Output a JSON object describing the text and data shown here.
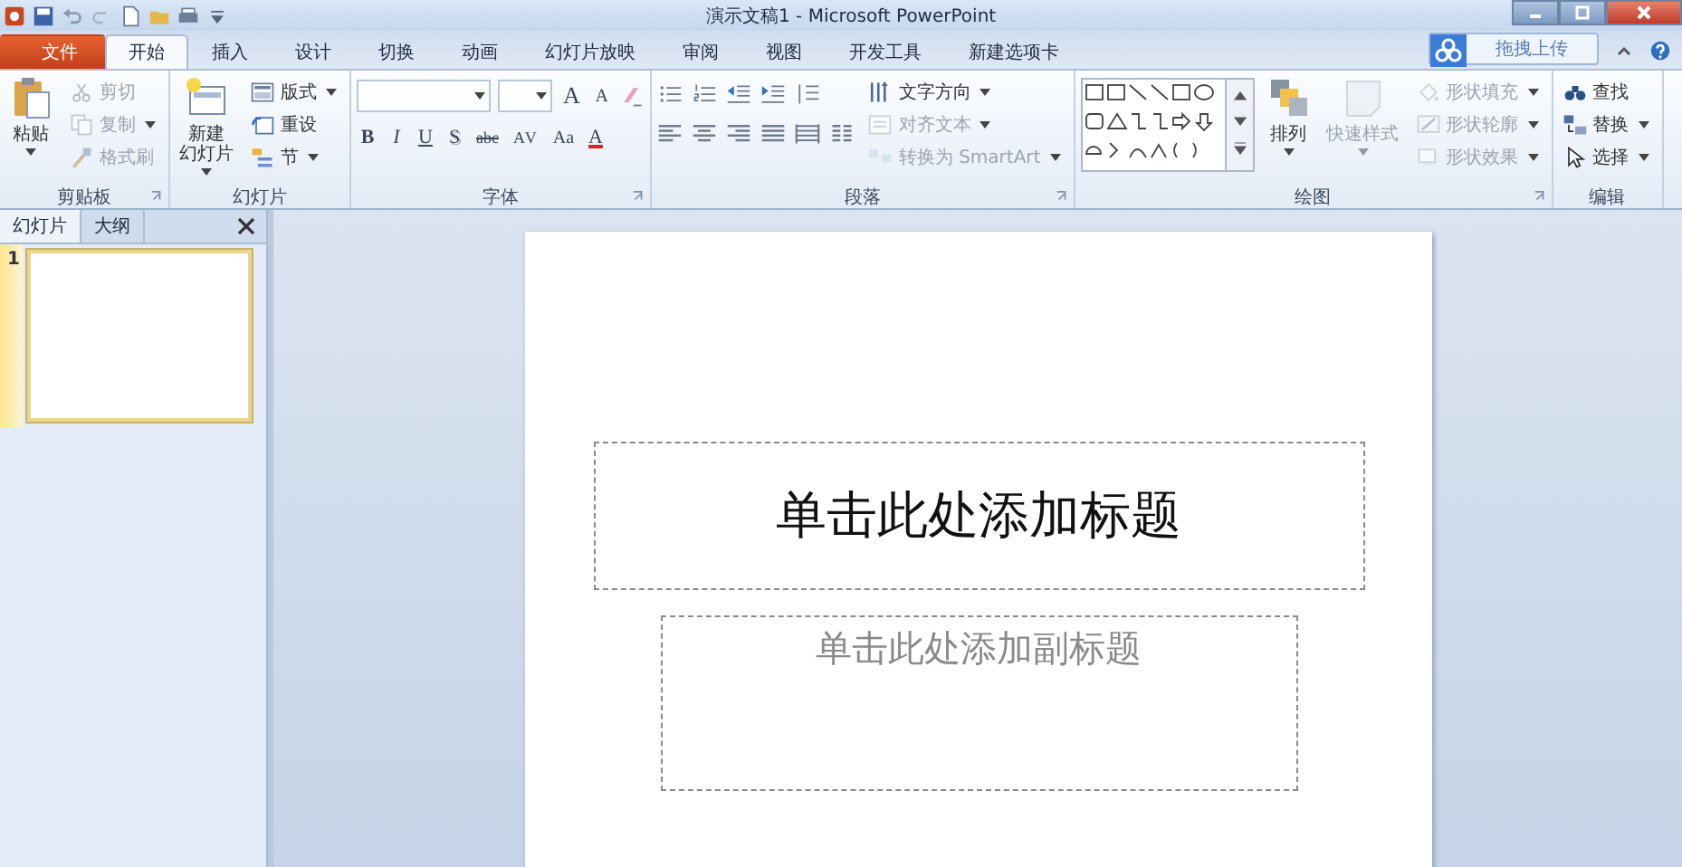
{
  "window": {
    "title": "演示文稿1 - Microsoft PowerPoint"
  },
  "tabs": [
    {
      "label": "文件",
      "kind": "file",
      "selected": false
    },
    {
      "label": "开始",
      "kind": "tab",
      "selected": true
    },
    {
      "label": "插入",
      "kind": "tab",
      "selected": false
    },
    {
      "label": "设计",
      "kind": "tab",
      "selected": false
    },
    {
      "label": "切换",
      "kind": "tab",
      "selected": false
    },
    {
      "label": "动画",
      "kind": "tab",
      "selected": false
    },
    {
      "label": "幻灯片放映",
      "kind": "tab",
      "selected": false
    },
    {
      "label": "审阅",
      "kind": "tab",
      "selected": false
    },
    {
      "label": "视图",
      "kind": "tab",
      "selected": false
    },
    {
      "label": "开发工具",
      "kind": "tab",
      "selected": false
    },
    {
      "label": "新建选项卡",
      "kind": "tab",
      "selected": false
    }
  ],
  "upload_button": {
    "label": "拖拽上传"
  },
  "ribbon": {
    "clipboard": {
      "label": "剪贴板",
      "launcher": true,
      "paste": {
        "label": "粘贴"
      },
      "items": [
        {
          "label": "剪切",
          "kind": "cut",
          "disabled": true,
          "dropdown": false
        },
        {
          "label": "复制",
          "kind": "copy",
          "disabled": true,
          "dropdown": true
        },
        {
          "label": "格式刷",
          "kind": "brush",
          "disabled": true,
          "dropdown": false
        }
      ]
    },
    "slides": {
      "label": "幻灯片",
      "launcher": false,
      "new_slide": {
        "lines": [
          "新建",
          "幻灯片"
        ]
      },
      "items": [
        {
          "label": "版式",
          "kind": "layout",
          "disabled": false,
          "dropdown": true
        },
        {
          "label": "重设",
          "kind": "reset",
          "disabled": false,
          "dropdown": false
        },
        {
          "label": "节",
          "kind": "section",
          "disabled": false,
          "dropdown": true
        }
      ]
    },
    "font": {
      "label": "字体",
      "launcher": true,
      "top_buttons": [
        {
          "label": "A",
          "kind": "grow"
        },
        {
          "label": "A",
          "kind": "shrink"
        }
      ],
      "buttons": [
        {
          "label": "B",
          "kind": "bold"
        },
        {
          "label": "I",
          "kind": "italic"
        },
        {
          "label": "U",
          "kind": "underline"
        },
        {
          "label": "S",
          "kind": "shadow"
        },
        {
          "label": "abc",
          "kind": "strike"
        },
        {
          "label": "AV",
          "kind": "spacing"
        },
        {
          "label": "Aa",
          "kind": "case"
        },
        {
          "label": "A",
          "kind": "color"
        }
      ]
    },
    "paragraph": {
      "label": "段落",
      "launcher": true,
      "items": [
        {
          "label": "文字方向",
          "kind": "textdir",
          "disabled": false,
          "dropdown": true
        },
        {
          "label": "对齐文本",
          "kind": "align",
          "disabled": true,
          "dropdown": true
        },
        {
          "label": "转换为 SmartArt",
          "kind": "smartart",
          "disabled": true,
          "dropdown": true
        }
      ]
    },
    "drawing": {
      "label": "绘图",
      "launcher": true,
      "arrange": {
        "label": "排列"
      },
      "quick_styles": {
        "label": "快速样式",
        "disabled": true
      },
      "items": [
        {
          "label": "形状填充",
          "kind": "fill",
          "disabled": true,
          "dropdown": true
        },
        {
          "label": "形状轮廓",
          "kind": "outline",
          "disabled": true,
          "dropdown": true
        },
        {
          "label": "形状效果",
          "kind": "effect",
          "disabled": true,
          "dropdown": true
        }
      ]
    },
    "editing": {
      "label": "编辑",
      "launcher": false,
      "items": [
        {
          "label": "查找",
          "kind": "find",
          "disabled": false,
          "dropdown": false
        },
        {
          "label": "替换",
          "kind": "replace",
          "disabled": false,
          "dropdown": true
        },
        {
          "label": "选择",
          "kind": "select",
          "disabled": false,
          "dropdown": true
        }
      ]
    }
  },
  "slide_pane": {
    "tabs": [
      {
        "label": "幻灯片",
        "selected": true
      },
      {
        "label": "大纲",
        "selected": false
      }
    ],
    "thumbnails": [
      {
        "number": "1",
        "selected": true
      }
    ]
  },
  "slide": {
    "title_placeholder": "单击此处添加标题",
    "subtitle_placeholder": "单击此处添加副标题"
  }
}
